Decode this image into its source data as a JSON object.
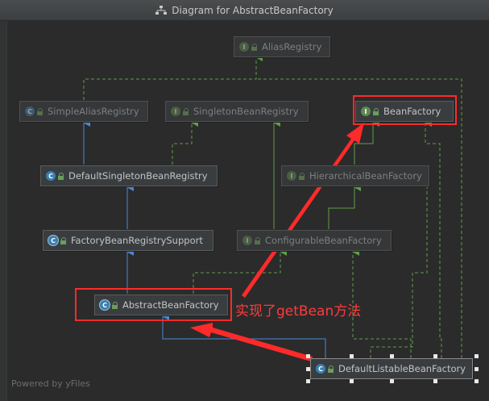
{
  "window": {
    "title": "Diagram for AbstractBeanFactory"
  },
  "nodes": {
    "alias_registry": {
      "label": "AliasRegistry",
      "kind": "I"
    },
    "simple_alias_registry": {
      "label": "SimpleAliasRegistry",
      "kind": "C"
    },
    "singleton_bean_registry": {
      "label": "SingletonBeanRegistry",
      "kind": "I"
    },
    "bean_factory": {
      "label": "BeanFactory",
      "kind": "I"
    },
    "default_singleton_bean_registry": {
      "label": "DefaultSingletonBeanRegistry",
      "kind": "C"
    },
    "hierarchical_bean_factory": {
      "label": "HierarchicalBeanFactory",
      "kind": "I"
    },
    "factory_bean_registry_support": {
      "label": "FactoryBeanRegistrySupport",
      "kind": "C"
    },
    "configurable_bean_factory": {
      "label": "ConfigurableBeanFactory",
      "kind": "I"
    },
    "abstract_bean_factory": {
      "label": "AbstractBeanFactory",
      "kind": "C"
    },
    "default_listable_bean_factory": {
      "label": "DefaultListableBeanFactory",
      "kind": "C"
    }
  },
  "annotation": {
    "text": "实现了getBean方法",
    "color": "#ff2a2a"
  },
  "footer": {
    "powered_by": "Powered by yFiles"
  },
  "colors": {
    "implements_edge": "#5f9d4a",
    "extends_edge": "#4a88d8",
    "background": "#2b2b2b"
  }
}
